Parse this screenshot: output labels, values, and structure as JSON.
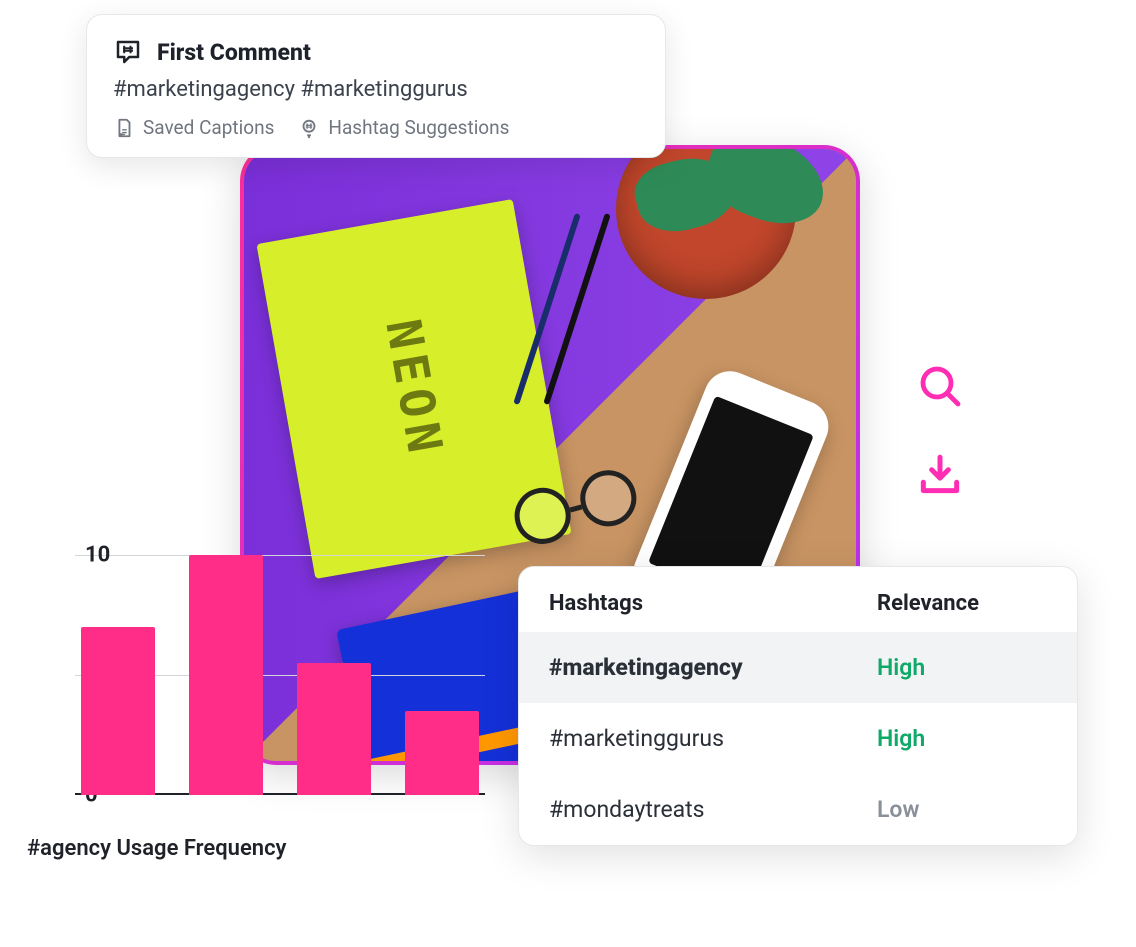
{
  "comment": {
    "title": "First Comment",
    "text": "#marketingagency #marketinggurus",
    "saved_captions": "Saved Captions",
    "hashtag_suggestions": "Hashtag Suggestions"
  },
  "chart_data": {
    "type": "bar",
    "title": "#agency Usage Frequency",
    "categories": [
      "",
      "",
      "",
      ""
    ],
    "values": [
      7,
      10,
      5.5,
      3.5
    ],
    "ylim": [
      0,
      10
    ],
    "ticks": [
      "10",
      "5",
      "0"
    ]
  },
  "hashtag_table": {
    "headers": {
      "col1": "Hashtags",
      "col2": "Relevance"
    },
    "rows": [
      {
        "tag": "#marketingagency",
        "relevance": "High",
        "selected": true
      },
      {
        "tag": "#marketinggurus",
        "relevance": "High",
        "selected": false
      },
      {
        "tag": "#mondaytreats",
        "relevance": "Low",
        "selected": false
      }
    ]
  },
  "colors": {
    "pink": "#ff2d87",
    "magenta_icon": "#ff2db3",
    "green": "#0fa968",
    "grey": "#8a9099"
  }
}
